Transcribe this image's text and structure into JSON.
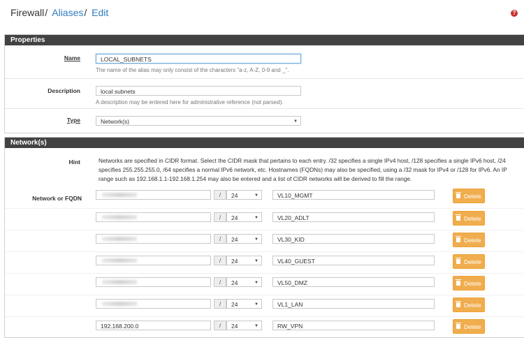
{
  "breadcrumb": {
    "root": "Firewall",
    "section": "Aliases",
    "current": "Edit",
    "separator": "/"
  },
  "help_icon": "question-circle-icon",
  "properties": {
    "heading": "Properties",
    "name": {
      "label": "Name",
      "value_prefix": "LOCAL_",
      "value_suffix": "SUBNETS",
      "help": "The name of the alias may only consist of the characters \"a-z, A-Z, 0-9 and _\"."
    },
    "description": {
      "label": "Description",
      "value": "local subnets",
      "help": "A description may be entered here for administrative reference (not parsed)."
    },
    "type": {
      "label": "Type",
      "value": "Network(s)"
    }
  },
  "networks": {
    "heading": "Network(s)",
    "hint_label": "Hint",
    "hint": "Networks are specified in CIDR format. Select the CIDR mask that pertains to each entry. /32 specifies a single IPv4 host, /128 specifies a single IPv6 host, /24 specifies 255.255.255.0, /64 specifies a normal IPv6 network, etc. Hostnames (FQDNs) may also be specified, using a /32 mask for IPv4 or /128 for IPv6. An IP range such as 192.168.1.1-192.168.1.254 may also be entered and a list of CIDR networks will be derived to fill the range.",
    "entry_label": "Network or FQDN",
    "slash": "/",
    "delete_label": "Delete",
    "entries": [
      {
        "address": "",
        "mask": "24",
        "description": "VL10_MGMT"
      },
      {
        "address": "",
        "mask": "24",
        "description": "VL20_ADLT"
      },
      {
        "address": "",
        "mask": "24",
        "description": "VL30_KID"
      },
      {
        "address": "",
        "mask": "24",
        "description": "VL40_GUEST"
      },
      {
        "address": "",
        "mask": "24",
        "description": "VL50_DMZ"
      },
      {
        "address": "",
        "mask": "24",
        "description": "VL1_LAN"
      },
      {
        "address": "192.168.200.0",
        "mask": "24",
        "description": "RW_VPN"
      }
    ]
  },
  "colors": {
    "accent": "#2f7bbf",
    "panel_header": "#424242",
    "delete": "#f0ad4e",
    "help": "#c9302c"
  }
}
